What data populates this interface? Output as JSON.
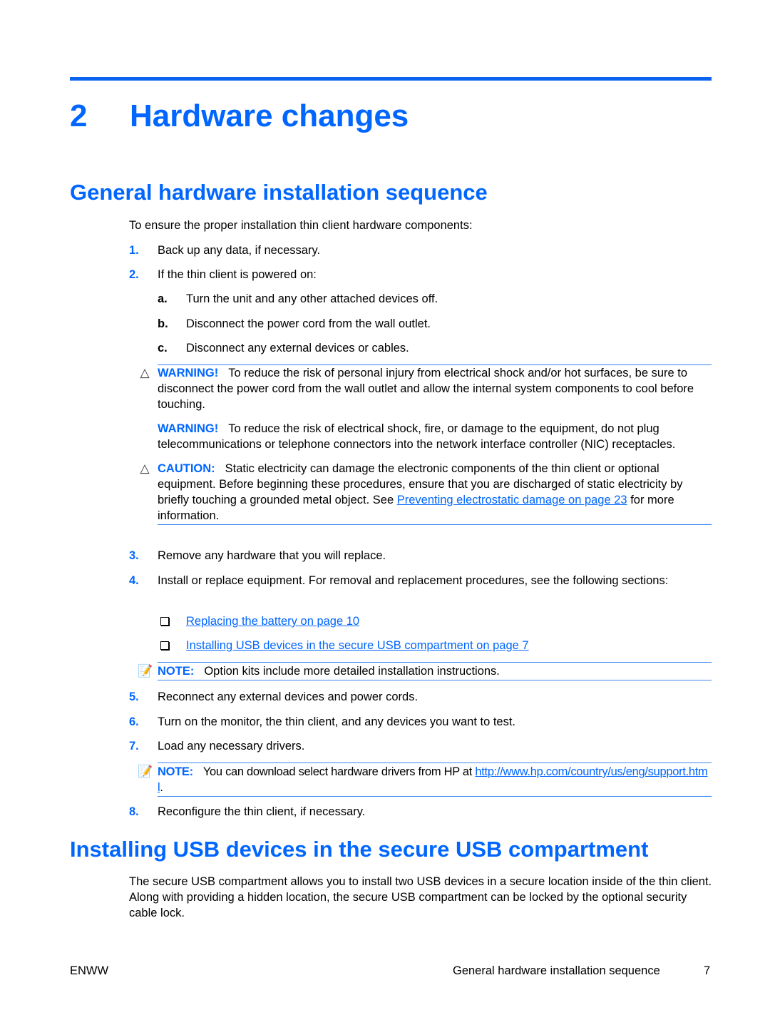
{
  "chapter": {
    "number": "2",
    "title": "Hardware changes"
  },
  "section1": {
    "title": "General hardware installation sequence",
    "intro": "To ensure the proper installation thin client hardware components:",
    "steps": [
      {
        "n": "1.",
        "text": "Back up any data, if necessary."
      },
      {
        "n": "2.",
        "text": "If the thin client is powered on:"
      },
      {
        "n": "3.",
        "text": "Remove any hardware that you will replace."
      },
      {
        "n": "4.",
        "text": "Install or replace equipment. For removal and replacement procedures, see the following sections:"
      },
      {
        "n": "5.",
        "text": "Reconnect any external devices and power cords."
      },
      {
        "n": "6.",
        "text": "Turn on the monitor, the thin client, and any devices you want to test."
      },
      {
        "n": "7.",
        "text": "Load any necessary drivers."
      },
      {
        "n": "8.",
        "text": "Reconfigure the thin client, if necessary."
      }
    ],
    "substeps": [
      {
        "n": "a.",
        "text": "Turn the unit and any other attached devices off."
      },
      {
        "n": "b.",
        "text": "Disconnect the power cord from the wall outlet."
      },
      {
        "n": "c.",
        "text": "Disconnect any external devices or cables."
      }
    ],
    "warning1": {
      "label": "WARNING!",
      "text": "To reduce the risk of personal injury from electrical shock and/or hot surfaces, be sure to disconnect the power cord from the wall outlet and allow the internal system components to cool before touching."
    },
    "warning2": {
      "label": "WARNING!",
      "text": "To reduce the risk of electrical shock, fire, or damage to the equipment, do not plug telecommunications or telephone connectors into the network interface controller (NIC) receptacles."
    },
    "caution": {
      "label": "CAUTION:",
      "text_before": "Static electricity can damage the electronic components of the thin client or optional equipment. Before beginning these procedures, ensure that you are discharged of static electricity by briefly touching a grounded metal object. See ",
      "link": "Preventing electrostatic damage on page 23",
      "text_after": " for more information."
    },
    "section_links": [
      "Replacing the battery on page 10",
      "Installing USB devices in the secure USB compartment on page 7"
    ],
    "note1": {
      "label": "NOTE:",
      "text": "Option kits include more detailed installation instructions."
    },
    "note2": {
      "label": "NOTE:",
      "text_before": "You can download select hardware drivers from HP at ",
      "link": "http://www.hp.com/country/us/eng/support.html",
      "text_after": "."
    }
  },
  "section2": {
    "title": "Installing USB devices in the secure USB compartment",
    "body": "The secure USB compartment allows you to install two USB devices in a secure location inside of the thin client. Along with providing a hidden location, the secure USB compartment can be locked by the optional security cable lock."
  },
  "footer": {
    "left": "ENWW",
    "section": "General hardware installation sequence",
    "page": "7"
  },
  "icons": {
    "warning": "warning-triangle-icon",
    "caution": "caution-triangle-icon",
    "note": "note-pad-icon",
    "bullet": "checkbox-bullet-icon"
  }
}
